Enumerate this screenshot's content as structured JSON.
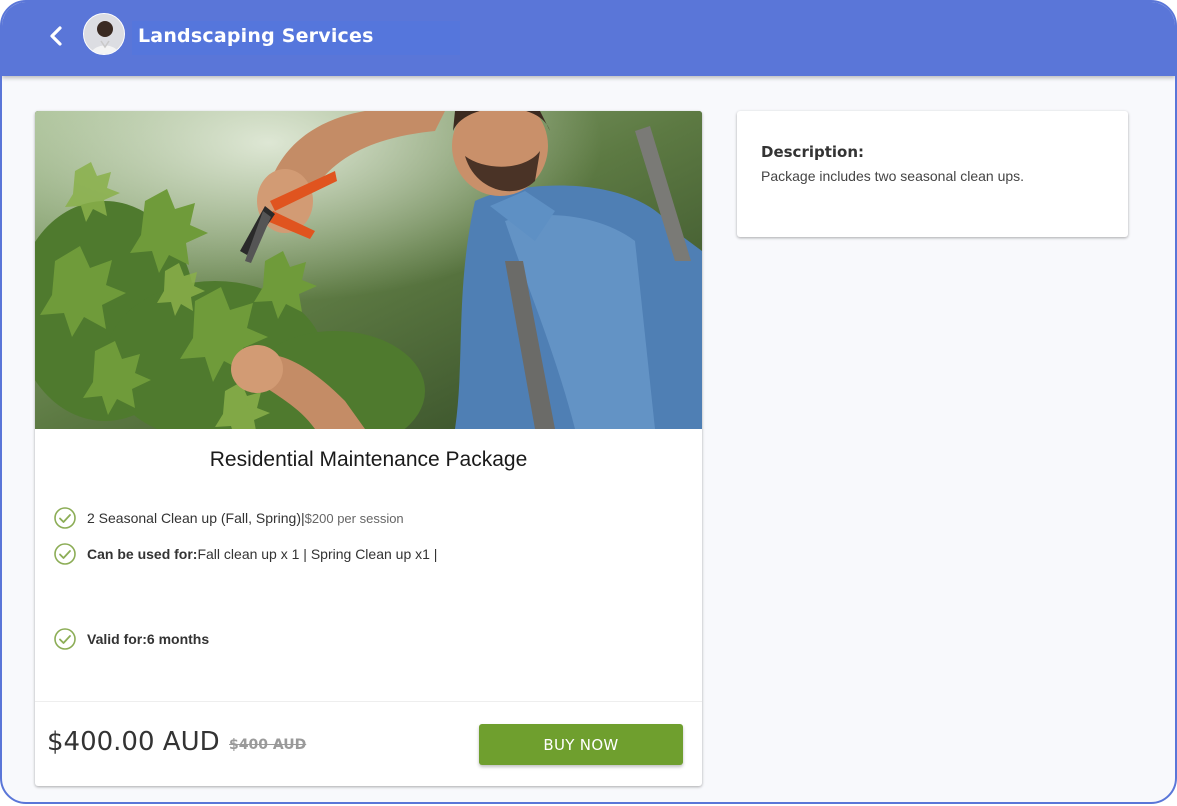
{
  "header": {
    "title": "Landscaping Services",
    "background": "#5a76d8"
  },
  "package": {
    "title": "Residential Maintenance Package",
    "features": [
      {
        "main": "2 Seasonal Clean up (Fall, Spring)|",
        "extra": " $200 per session"
      },
      {
        "label": "Can be used for:",
        "value": " Fall clean up x 1 | Spring Clean up x1 |"
      },
      {
        "label": "Valid for:",
        "value": " 6 months"
      }
    ],
    "price": "$400.00 AUD",
    "original_price": "$400 AUD",
    "buy_label": "BUY NOW",
    "accent": "#6f9f2e"
  },
  "description": {
    "label": "Description:",
    "text": "Package includes two seasonal clean ups."
  },
  "icons": {
    "back": "chevron-left-icon",
    "check": "check-circle-icon"
  }
}
